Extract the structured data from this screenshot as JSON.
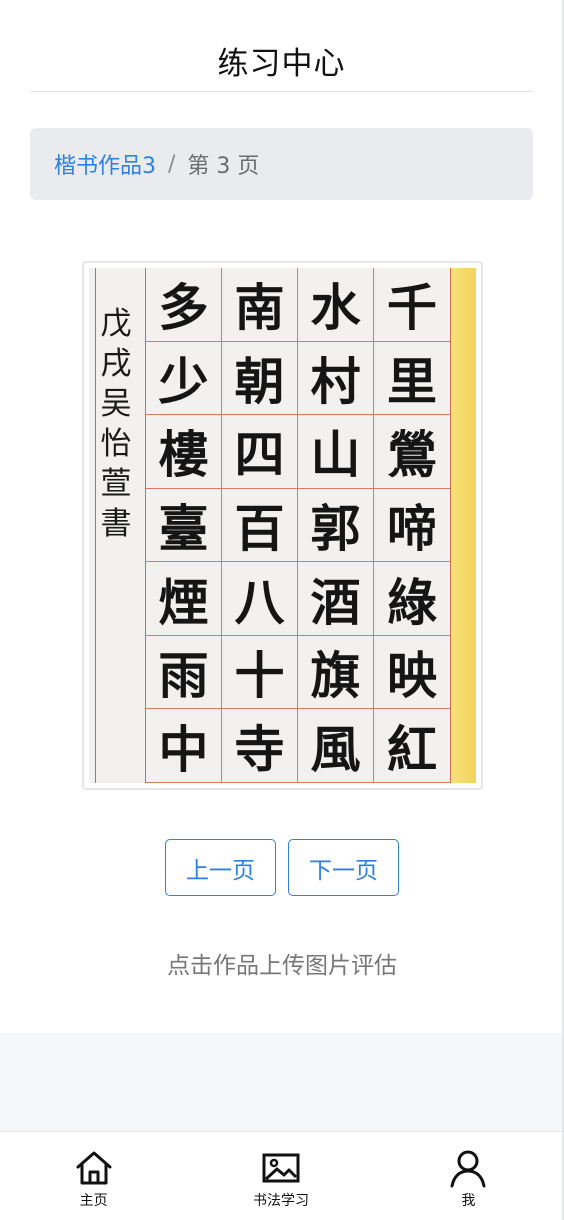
{
  "header": {
    "title": "练习中心"
  },
  "breadcrumb": {
    "parent": "楷书作品3",
    "separator": "/",
    "current": "第 3 页"
  },
  "artwork": {
    "columns": [
      [
        "千",
        "里",
        "鶯",
        "啼",
        "綠",
        "映",
        "紅"
      ],
      [
        "水",
        "村",
        "山",
        "郭",
        "酒",
        "旗",
        "風"
      ],
      [
        "南",
        "朝",
        "四",
        "百",
        "八",
        "十",
        "寺"
      ],
      [
        "多",
        "少",
        "樓",
        "臺",
        "煙",
        "雨",
        "中"
      ]
    ],
    "signature": [
      "戊",
      "戌",
      "吴",
      "怡",
      "萱",
      "書"
    ]
  },
  "pager": {
    "prev_label": "上一页",
    "next_label": "下一页"
  },
  "hint": "点击作品上传图片评估",
  "tabbar": {
    "items": [
      {
        "label": "主页",
        "icon": "home-icon"
      },
      {
        "label": "书法学习",
        "icon": "image-icon"
      },
      {
        "label": "我",
        "icon": "user-icon"
      }
    ]
  }
}
